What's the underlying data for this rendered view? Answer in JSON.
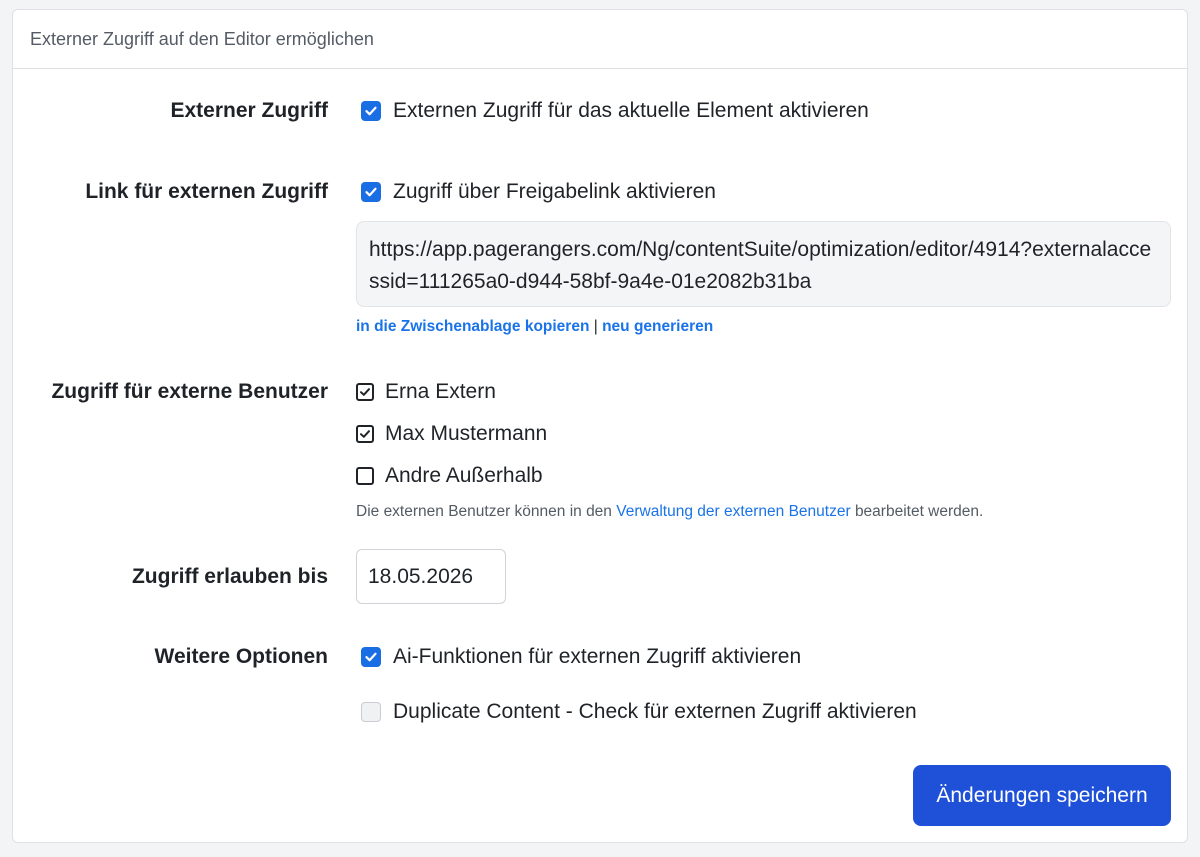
{
  "card": {
    "title": "Externer Zugriff auf den Editor ermöglichen"
  },
  "external_access": {
    "label": "Externer Zugriff",
    "checkbox_label": "Externen Zugriff für das aktuelle Element aktivieren",
    "checked": true
  },
  "share_link": {
    "label": "Link für externen Zugriff",
    "checkbox_label": "Zugriff über Freigabelink aktivieren",
    "checked": true,
    "url": "https://app.pagerangers.com/Ng/contentSuite/optimization/editor/4914?externalaccessid=111265a0-d944-58bf-9a4e-01e2082b31ba",
    "copy_link": "in die Zwischenablage kopieren",
    "separator": "|",
    "regenerate_link": "neu generieren"
  },
  "external_users": {
    "label": "Zugriff für externe Benutzer",
    "users": [
      {
        "name": "Erna Extern",
        "checked": true
      },
      {
        "name": "Max Mustermann",
        "checked": true
      },
      {
        "name": "Andre Außerhalb",
        "checked": false
      }
    ],
    "hint_before": "Die externen Benutzer können in den",
    "hint_link": "Verwaltung der externen Benutzer",
    "hint_after": "bearbeitet werden."
  },
  "allow_until": {
    "label": "Zugriff erlauben bis",
    "value": "18.05.2026"
  },
  "more_options": {
    "label": "Weitere Optionen",
    "ai_label": "Ai-Funktionen für externen Zugriff aktivieren",
    "ai_checked": true,
    "dc_label": "Duplicate Content - Check für externen Zugriff aktivieren",
    "dc_checked": false
  },
  "save_button": "Änderungen speichern",
  "colors": {
    "accent": "#1a6ee3",
    "button": "#1f51d8",
    "link": "#1a73e8"
  }
}
